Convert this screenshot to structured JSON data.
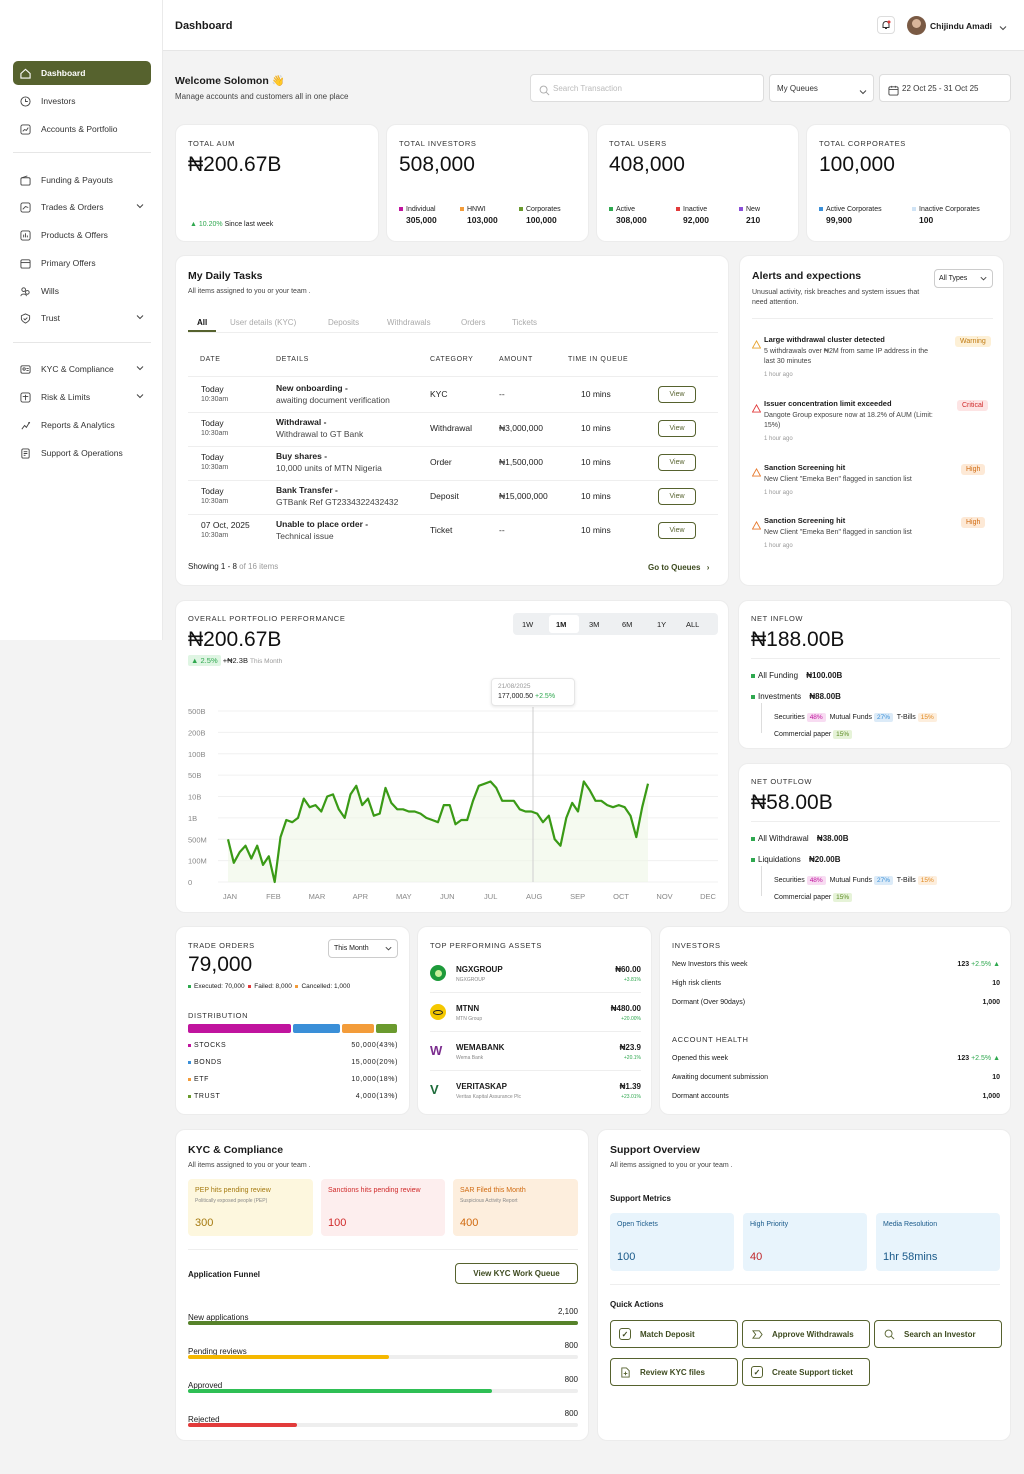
{
  "header": {
    "title": "Dashboard",
    "user_name": "Chijindu Amadi"
  },
  "sidebar": {
    "items": [
      {
        "label": "Dashboard",
        "icon": "home-icon"
      },
      {
        "label": "Investors",
        "icon": "clock-icon"
      },
      {
        "label": "Accounts & Portfolio",
        "icon": "chart-line-icon"
      },
      {
        "label": "Funding & Payouts",
        "icon": "wallet-icon"
      },
      {
        "label": "Trades & Orders",
        "icon": "trend-icon"
      },
      {
        "label": "Products & Offers",
        "icon": "bars-icon"
      },
      {
        "label": "Primary Offers",
        "icon": "calendar-icon"
      },
      {
        "label": "Wills",
        "icon": "people-icon"
      },
      {
        "label": "Trust",
        "icon": "shield-icon"
      },
      {
        "label": "KYC & Compliance",
        "icon": "id-card-icon"
      },
      {
        "label": "Risk & Limits",
        "icon": "scale-icon"
      },
      {
        "label": "Reports & Analytics",
        "icon": "report-icon"
      },
      {
        "label": "Support & Operations",
        "icon": "document-icon"
      }
    ]
  },
  "welcome": {
    "title": "Welcome Solomon 👋",
    "subtitle": "Manage accounts and customers all in one place",
    "search_placeholder": "Search Transaction",
    "queue_select": "My Queues",
    "date_range": "22 Oct 25 - 31 Oct 25"
  },
  "kpis": {
    "aum": {
      "label": "TOTAL AUM",
      "value": "₦200.67B",
      "change": "10.20%",
      "change_text": "Since last week"
    },
    "investors": {
      "label": "TOTAL INVESTORS",
      "value": "508,000",
      "items": [
        {
          "name": "Individual",
          "value": "305,000",
          "color": "#c0149e"
        },
        {
          "name": "HNWI",
          "value": "103,000",
          "color": "#f39c3a"
        },
        {
          "name": "Corporates",
          "value": "100,000",
          "color": "#6a9a2e"
        }
      ]
    },
    "users": {
      "label": "TOTAL USERS",
      "value": "408,000",
      "items": [
        {
          "name": "Active",
          "value": "308,000",
          "color": "#2fa84f"
        },
        {
          "name": "Inactive",
          "value": "92,000",
          "color": "#e23b3b"
        },
        {
          "name": "New",
          "value": "210",
          "color": "#8a4fd8"
        }
      ]
    },
    "corporates": {
      "label": "TOTAL CORPORATES",
      "value": "100,000",
      "items": [
        {
          "name": "Active Corporates",
          "value": "99,900",
          "color": "#3a8fd8"
        },
        {
          "name": "Inactive Corporates",
          "value": "100",
          "color": "#cfe3f5"
        }
      ]
    }
  },
  "tasks": {
    "title": "My Daily Tasks",
    "subtitle": "All items assigned to you or your team .",
    "tabs": [
      "All",
      "User details (KYC)",
      "Deposits",
      "Withdrawals",
      "Orders",
      "Tickets"
    ],
    "columns": [
      "DATE",
      "DETAILS",
      "CATEGORY",
      "AMOUNT",
      "TIME IN QUEUE"
    ],
    "rows": [
      {
        "date": "Today",
        "time": "10:30am",
        "title": "New onboarding -",
        "desc": "awaiting document verification",
        "category": "KYC",
        "amount": "--",
        "queue": "10 mins",
        "action": "View"
      },
      {
        "date": "Today",
        "time": "10:30am",
        "title": "Withdrawal -",
        "desc": "Withdrawal to GT Bank",
        "category": "Withdrawal",
        "amount": "₦3,000,000",
        "queue": "10 mins",
        "action": "View"
      },
      {
        "date": "Today",
        "time": "10:30am",
        "title": "Buy shares -",
        "desc": "10,000 units of MTN Nigeria",
        "category": "Order",
        "amount": "₦1,500,000",
        "queue": "10 mins",
        "action": "View"
      },
      {
        "date": "Today",
        "time": "10:30am",
        "title": "Bank Transfer -",
        "desc": "GTBank Ref GT2334322432432",
        "category": "Deposit",
        "amount": "₦15,000,000",
        "queue": "10 mins",
        "action": "View"
      },
      {
        "date": "07 Oct, 2025",
        "time": "10:30am",
        "title": "Unable to place order  -",
        "desc": "Technical issue",
        "category": "Ticket",
        "amount": "--",
        "queue": "10 mins",
        "action": "View"
      }
    ],
    "showing": "Showing 1 - 8",
    "showing_of": "of 16 items",
    "goto": "Go to Queues"
  },
  "alerts": {
    "title": "Alerts and expections",
    "subtitle": "Unusual activity, risk breaches and system issues that need attention.",
    "filter": "All Types",
    "items": [
      {
        "title": "Large withdrawal cluster detected",
        "desc": "5 withdrawals over ₦2M from same IP address in the last 30 minutes",
        "time": "1 hour ago",
        "badge": "Warning"
      },
      {
        "title": "Issuer concentration limit exceeded",
        "desc": "Dangote Group exposure now at 18.2% of AUM (Limit: 15%)",
        "time": "1 hour ago",
        "badge": "Critical"
      },
      {
        "title": "Sanction Screening hit",
        "desc": "New Client \"Emeka Ben\" flagged in sanction list",
        "time": "1 hour ago",
        "badge": "High"
      },
      {
        "title": "Sanction Screening hit",
        "desc": "New Client \"Emeka Ben\" flagged in sanction list",
        "time": "1 hour ago",
        "badge": "High"
      }
    ]
  },
  "performance": {
    "label": "OVERALL PORTFOLIO PERFORMANCE",
    "value": "₦200.67B",
    "change": "2.5%",
    "delta": "+₦2.3B",
    "period": "This Month",
    "ranges": [
      "1W",
      "1M",
      "3M",
      "6M",
      "1Y",
      "ALL"
    ],
    "active_range": "1M",
    "tooltip_date": "21/08/2025",
    "tooltip_value": "177,000.50",
    "tooltip_change": "+2.5%"
  },
  "chart_data": {
    "type": "line",
    "title": "",
    "y_ticks": [
      "500B",
      "200B",
      "100B",
      "50B",
      "10B",
      "1B",
      "500M",
      "100M",
      "0"
    ],
    "x_ticks": [
      "JAN",
      "FEB",
      "MAR",
      "APR",
      "MAY",
      "JUN",
      "JUL",
      "AUG",
      "SEP",
      "OCT",
      "NOV",
      "DEC"
    ],
    "series": [
      {
        "values": [
          2,
          0.9,
          1.4,
          1.7,
          1.1,
          1.7,
          0.8,
          1.2,
          0.0,
          2.1,
          2.9,
          2.8,
          3.0,
          3.9,
          3.5,
          3.6,
          3.3,
          4.0,
          4.1,
          3.4,
          3.0,
          4.1,
          4.5,
          3.6,
          3.9,
          3.1,
          3.2,
          4.4,
          3.7,
          3.4,
          3.4,
          3.3,
          3.3,
          3.2,
          3.0,
          2.9,
          2.8,
          3.6,
          3.6,
          2.7,
          2.9,
          2.9,
          3.8,
          4.5,
          4.6,
          4.7,
          4.4,
          3.8,
          3.8,
          3.8,
          3.4,
          3.3,
          3.3,
          3.2,
          2.8,
          3.1,
          2.0,
          1.7,
          3.0,
          3.7,
          3.3,
          4.7,
          4.3,
          3.8,
          3.8,
          3.6,
          3.5,
          3.6,
          3.5,
          3.1,
          2.1,
          3.5,
          4.6
        ]
      }
    ],
    "color": "#3a9a16"
  },
  "net_inflow": {
    "label": "NET INFLOW",
    "value": "₦188.00B",
    "all_funding_label": "All Funding",
    "all_funding": "₦100.00B",
    "investments_label": "Investments",
    "investments": "₦88.00B",
    "breakdown": [
      {
        "name": "Securities",
        "pct": "48%",
        "color": "#c0149e"
      },
      {
        "name": "Mutual Funds",
        "pct": "27%",
        "color": "#3a8fd8"
      },
      {
        "name": "T-Bills",
        "pct": "15%",
        "color": "#f39c3a"
      },
      {
        "name": "Commercial paper",
        "pct": "15%",
        "color": "#6a9a2e"
      }
    ]
  },
  "net_outflow": {
    "label": "NET OUTFLOW",
    "value": "₦58.00B",
    "all_label": "All Withdrawal",
    "all_value": "₦38.00B",
    "liq_label": "Liquidations",
    "liq_value": "₦20.00B",
    "breakdown": [
      {
        "name": "Securities",
        "pct": "48%"
      },
      {
        "name": "Mutual Funds",
        "pct": "27%"
      },
      {
        "name": "T-Bills",
        "pct": "15%"
      },
      {
        "name": "Commercial paper",
        "pct": "15%"
      }
    ]
  },
  "trade_orders": {
    "label": "TRADE ORDERS",
    "value": "79,000",
    "period": "This Month",
    "executed": "Executed: 70,000",
    "failed": "Failed: 8,000",
    "cancelled": "Cancelled: 1,000",
    "dist_label": "DISTRIBUTION",
    "dist": [
      {
        "name": "STOCKS",
        "value": "50,000(43%)",
        "color": "#c0149e",
        "pct": 43
      },
      {
        "name": "BONDS",
        "value": "15,000(20%)",
        "color": "#3a8fd8",
        "pct": 20
      },
      {
        "name": "ETF",
        "value": "10,000(18%)",
        "color": "#f39c3a",
        "pct": 18
      },
      {
        "name": "TRUST",
        "value": "4,000(13%)",
        "color": "#6a9a2e",
        "pct": 13
      }
    ]
  },
  "top_assets": {
    "label": "TOP PERFORMING ASSETS",
    "items": [
      {
        "name": "NGXGROUP",
        "sub": "NGXGROUP",
        "price": "₦60.00",
        "change": "+3.81%",
        "color": "#1d9a3a"
      },
      {
        "name": "MTNN",
        "sub": "MTN Group",
        "price": "₦480.00",
        "change": "+20.00%",
        "color": "#f5c800"
      },
      {
        "name": "WEMABANK",
        "sub": "Wema Bank",
        "price": "₦23.9",
        "change": "+20.1%",
        "color": "#7b2d8e"
      },
      {
        "name": "VERITASKAP",
        "sub": "Veritas Kapital Assurance Plc",
        "price": "₦1.39",
        "change": "+23.01%",
        "color": "#1d6b3a"
      }
    ]
  },
  "investors_panel": {
    "label": "INVESTORS",
    "rows": [
      {
        "name": "New Investors this week",
        "value": "123",
        "change": "+2.5%"
      },
      {
        "name": "High risk clients",
        "value": "10"
      },
      {
        "name": "Dormant (Over 90days)",
        "value": "1,000"
      }
    ],
    "health_label": "ACCOUNT HEALTH",
    "health": [
      {
        "name": "Opened this week",
        "value": "123",
        "change": "+2.5%"
      },
      {
        "name": "Awaiting document submission",
        "value": "10"
      },
      {
        "name": "Dormant accounts",
        "value": "1,000"
      }
    ]
  },
  "kyc": {
    "title": "KYC & Compliance",
    "subtitle": "All items assigned to you or your team .",
    "boxes": [
      {
        "title": "PEP hits pending review",
        "sub": "Politically exposed people (PEP)",
        "value": "300"
      },
      {
        "title": "Sanctions hits pending review",
        "sub": "",
        "value": "100"
      },
      {
        "title": "SAR Filed this Month",
        "sub": "Suspicious Activity Report",
        "value": "400"
      }
    ],
    "funnel_title": "Application Funnel",
    "funnel_btn": "View KYC Work Queue",
    "funnel": [
      {
        "name": "New applications",
        "value": "2,100",
        "pct": 100,
        "color": "#56822a"
      },
      {
        "name": "Pending reviews",
        "value": "800",
        "pct": 52,
        "color": "#f5b800"
      },
      {
        "name": "Approved",
        "value": "800",
        "pct": 78,
        "color": "#2fbf55"
      },
      {
        "name": "Rejected",
        "value": "800",
        "pct": 28,
        "color": "#e23b3b"
      }
    ]
  },
  "support": {
    "title": "Support Overview",
    "subtitle": "All items assigned to you or your team .",
    "metrics_title": "Support Metrics",
    "metrics": [
      {
        "name": "Open Tickets",
        "value": "100",
        "color": "#1a5a8a"
      },
      {
        "name": "High Priority",
        "value": "40",
        "color": "#c0262a"
      },
      {
        "name": "Media Resolution",
        "value": "1hr 58mins",
        "color": "#1a5a8a"
      }
    ],
    "qa_title": "Quick Actions",
    "actions": [
      "Match Deposit",
      "Approve Withdrawals",
      "Search an Investor",
      "Review KYC files",
      "Create Support ticket"
    ]
  }
}
